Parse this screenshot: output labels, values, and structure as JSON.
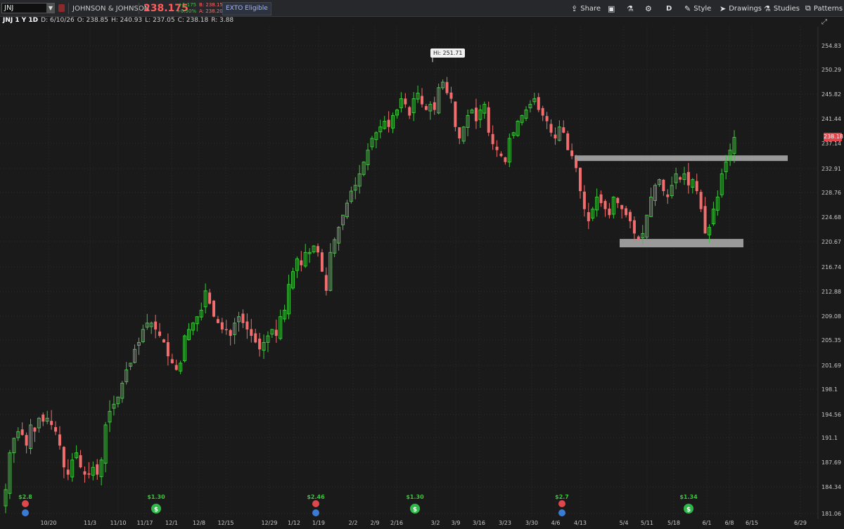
{
  "toolbar": {
    "symbol": "JNJ",
    "company": "JOHNSON & JOHNSON",
    "last": "238.175",
    "net_change": "+1.175",
    "pct_change": "+0.50%",
    "bid": "B: 238.15",
    "ask": "A: 238.20",
    "exto": "EXTO Eligible",
    "share": "Share",
    "period": "D",
    "style": "Style",
    "drawings": "Drawings",
    "studies": "Studies",
    "patterns": "Patterns"
  },
  "info": {
    "symbol": "JNJ 1 Y 1D",
    "date": "D: 6/10/26",
    "open": "O: 238.85",
    "high": "H: 240.93",
    "low": "L: 237.05",
    "close": "C: 238.18",
    "range": "R: 3.88"
  },
  "price_tag": "238.18",
  "hi_label": "Hi: 251.71",
  "colors": {
    "up": "#3ec53e",
    "down": "#f26d6d",
    "background": "#1a1a1a",
    "zone": "#9a9a9a",
    "grid": "#2c2c2c"
  },
  "chart_data": {
    "type": "candlestick",
    "ylim": [
      181.06,
      256.5
    ],
    "y_ticks": [
      "254.83",
      "250.29",
      "245.82",
      "241.44",
      "237.14",
      "232.91",
      "228.76",
      "224.68",
      "220.67",
      "216.74",
      "212.88",
      "209.08",
      "205.35",
      "201.69",
      "198.1",
      "194.56",
      "191.1",
      "187.69",
      "184.34",
      "181.06"
    ],
    "x_labels": [
      "10/20",
      "11/3",
      "11/10",
      "11/17",
      "12/1",
      "12/8",
      "12/15",
      "12/29",
      "1/12",
      "1/19",
      "2/2",
      "2/9",
      "2/16",
      "3/2",
      "3/9",
      "3/16",
      "3/23",
      "3/30",
      "4/6",
      "4/13",
      "5/4",
      "5/11",
      "5/18",
      "6/1",
      "6/8",
      "6/15",
      "6/29"
    ],
    "support_zone": [
      219.9,
      221.0
    ],
    "resistance_zone": [
      234.3,
      235.0
    ],
    "high_annotation": 251.71,
    "events": [
      {
        "label": "$2.8",
        "type": "earnings"
      },
      {
        "label": "$1.30",
        "type": "dividend"
      },
      {
        "label": "$2.46",
        "type": "earnings"
      },
      {
        "label": "$1.30",
        "type": "dividend"
      },
      {
        "label": "$2.7",
        "type": "earnings"
      },
      {
        "label": "$1.34",
        "type": "dividend"
      }
    ],
    "candles_sample_daily_close": [
      184,
      189,
      191,
      192,
      191.5,
      190,
      193,
      192,
      194,
      193.5,
      194,
      193,
      192,
      190,
      187,
      186,
      188,
      189,
      187,
      186,
      186,
      187,
      186,
      188,
      193,
      195,
      196,
      197,
      199,
      201,
      202,
      204,
      205,
      207,
      208,
      208,
      207,
      206,
      205,
      203,
      202,
      201,
      202,
      206,
      207,
      208,
      209,
      210,
      213,
      211,
      209,
      208,
      207,
      207,
      206,
      208,
      209,
      208,
      207,
      206,
      205,
      204,
      205,
      206,
      207,
      206,
      209,
      210,
      214,
      216,
      218,
      217,
      219,
      219,
      220,
      219,
      216,
      213,
      219,
      221,
      223,
      225,
      227,
      229,
      230,
      232,
      234,
      236,
      238,
      239,
      240,
      241,
      240,
      242,
      243,
      245,
      244,
      242,
      245,
      246,
      244,
      243,
      244,
      243,
      247,
      248,
      246,
      245,
      240,
      238,
      240,
      242,
      243,
      241,
      243,
      244,
      239,
      237,
      236,
      235,
      234,
      238,
      239,
      241,
      242,
      243,
      244,
      245,
      243,
      242,
      241,
      239,
      238,
      240,
      239,
      236,
      235,
      233,
      229,
      226,
      224,
      226,
      228,
      227,
      226,
      225,
      228,
      227,
      226,
      225,
      224,
      222,
      221,
      222,
      225,
      228,
      230,
      231,
      229,
      228,
      230,
      232,
      231,
      232,
      230,
      231,
      229,
      226,
      222,
      223,
      226,
      228,
      232,
      234,
      236,
      238.18
    ]
  }
}
